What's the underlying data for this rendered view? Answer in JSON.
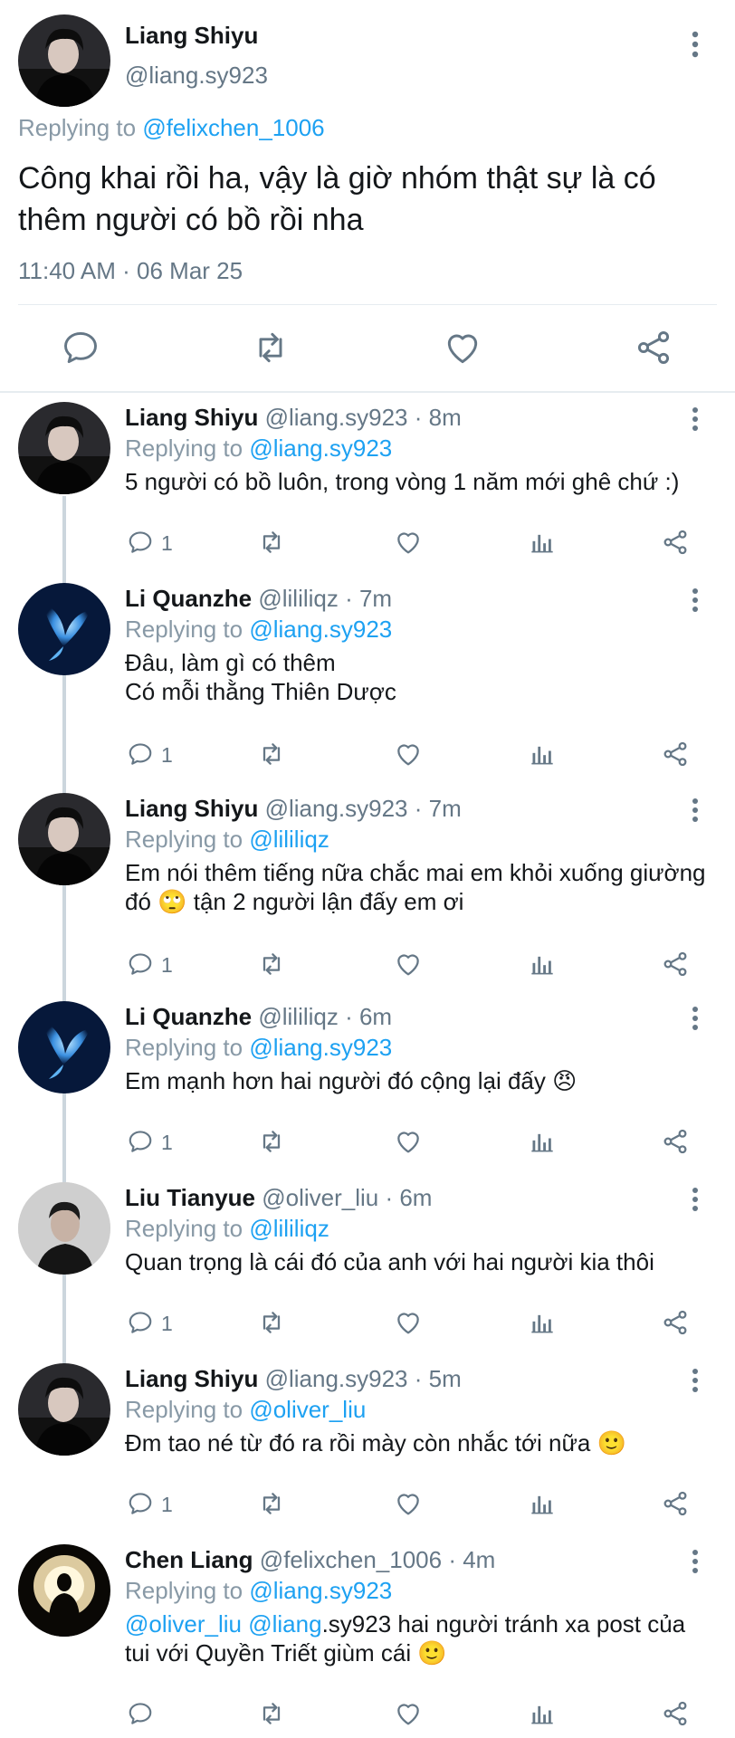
{
  "main_tweet": {
    "name": "Liang Shiyu",
    "handle": "@liang.sy923",
    "replying_prefix": "Replying to",
    "replying_to": "@felixchen_1006",
    "text": "Công khai rồi ha, vậy là giờ nhóm thật sự là có thêm người có bồ rồi nha",
    "timestamp": "11:40 AM · 06 Mar 25",
    "icons": [
      "reply-icon",
      "retweet-icon",
      "like-icon",
      "share-icon"
    ]
  },
  "replies": [
    {
      "name": "Liang Shiyu",
      "handle_time": "@liang.sy923 · 8m",
      "replying_prefix": "Replying to",
      "replying_to": "@liang.sy923",
      "text": "5 người có bồ luôn, trong vòng 1 năm mới ghê chứ :)",
      "reply_count": "1"
    },
    {
      "name": "Li Quanzhe",
      "handle_time": "@lililiqz · 7m",
      "replying_prefix": "Replying to",
      "replying_to": "@liang.sy923",
      "text": "Đâu, làm gì có thêm\nCó mỗi thằng Thiên Dược",
      "reply_count": "1"
    },
    {
      "name": "Liang Shiyu",
      "handle_time": "@liang.sy923 · 7m",
      "replying_prefix": "Replying to",
      "replying_to": "@lililiqz",
      "text": "Em nói thêm tiếng nữa chắc mai em khỏi xuống giường đó 🙄 tận 2 người lận đấy em ơi",
      "reply_count": "1"
    },
    {
      "name": "Li Quanzhe",
      "handle_time": "@lililiqz · 6m",
      "replying_prefix": "Replying to",
      "replying_to": "@liang.sy923",
      "text": "Em mạnh hơn hai người đó cộng lại đấy 😠",
      "reply_count": "1"
    },
    {
      "name": "Liu Tianyue",
      "handle_time": "@oliver_liu · 6m",
      "replying_prefix": "Replying to",
      "replying_to": "@lililiqz",
      "text": "Quan trọng là cái đó của anh với hai người kia thôi",
      "reply_count": "1"
    },
    {
      "name": "Liang Shiyu",
      "handle_time": "@liang.sy923 · 5m",
      "replying_prefix": "Replying to",
      "replying_to": "@oliver_liu",
      "text": "Đm tao né từ đó ra rồi mày còn nhắc tới nữa 🙂",
      "reply_count": "1"
    },
    {
      "name": "Chen Liang",
      "handle_time": "@felixchen_1006 · 4m",
      "replying_prefix": "Replying to",
      "replying_to": "@liang.sy923",
      "text_mention_1": "@oliver_liu",
      "text_mention_2": "@liang",
      "text_rest": ".sy923 hai người tránh xa post của tui với Quyền Triết giùm cái 🙂",
      "reply_count": ""
    }
  ],
  "colors": {
    "text": "#14171a",
    "secondary": "#657786",
    "link": "#1da1f2",
    "icon": "#657786",
    "thread_line": "#ccd6dd"
  }
}
